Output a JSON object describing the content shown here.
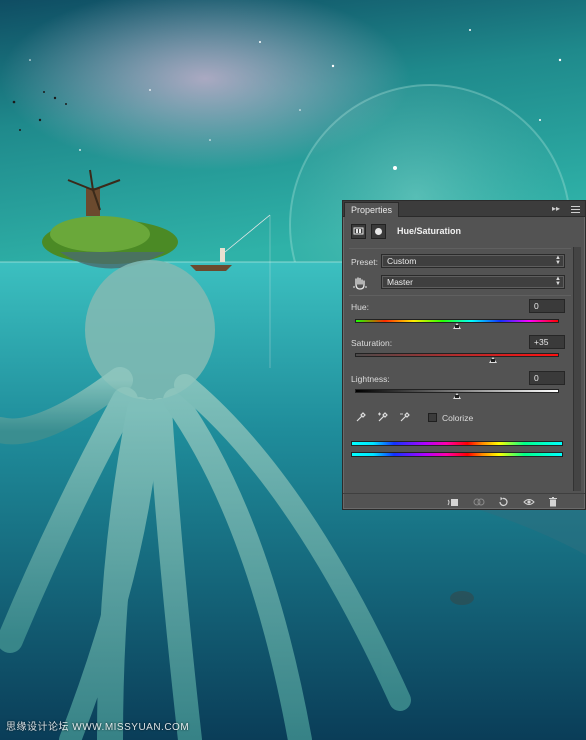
{
  "panel": {
    "tab_label": "Properties",
    "collapse_glyph": "▸▸",
    "title": "Hue/Saturation",
    "preset_label": "Preset:",
    "preset_value": "Custom",
    "channel_value": "Master",
    "hue_label": "Hue:",
    "hue_value": "0",
    "hue_fraction": 0.5,
    "saturation_label": "Saturation:",
    "saturation_value": "+35",
    "saturation_fraction": 0.675,
    "lightness_label": "Lightness:",
    "lightness_value": "0",
    "lightness_fraction": 0.5,
    "colorize_label": "Colorize",
    "colorize_checked": false
  },
  "icons": {
    "adjustment": "hue-saturation-adjustment-icon",
    "mask": "layer-mask-icon",
    "target_adjust": "hand-target-adjust-icon",
    "eyedroppers": [
      "eyedropper-icon",
      "eyedropper-plus-icon",
      "eyedropper-minus-icon"
    ],
    "footer": [
      "clip-to-layer-icon",
      "view-previous-state-icon",
      "reset-icon",
      "visibility-eye-icon",
      "trash-icon"
    ]
  },
  "colors": {
    "panel_bg": "#535353",
    "water_top": "#1c8c8e",
    "sky_top": "#0e4a5c"
  },
  "watermark": "思缘设计论坛 WWW.MISSYUAN.COM"
}
